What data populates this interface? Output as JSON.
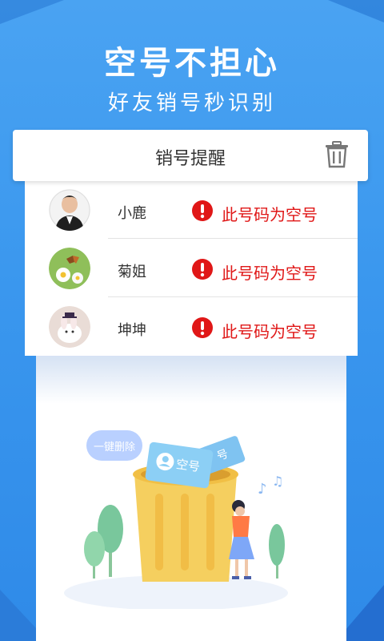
{
  "hero": {
    "title": "空号不担心",
    "subtitle": "好友销号秒识别"
  },
  "header": {
    "title": "销号提醒",
    "trash_icon": "trash-icon"
  },
  "contacts": [
    {
      "name": "小鹿",
      "status": "此号码为空号"
    },
    {
      "name": "菊姐",
      "status": "此号码为空号"
    },
    {
      "name": "坤坤",
      "status": "此号码为空号"
    }
  ],
  "illustration": {
    "bubble_text": "一键删除",
    "card_text": "空号"
  },
  "colors": {
    "accent": "#3a97ee",
    "warning": "#e01717",
    "bin": "#f5cf5f"
  }
}
